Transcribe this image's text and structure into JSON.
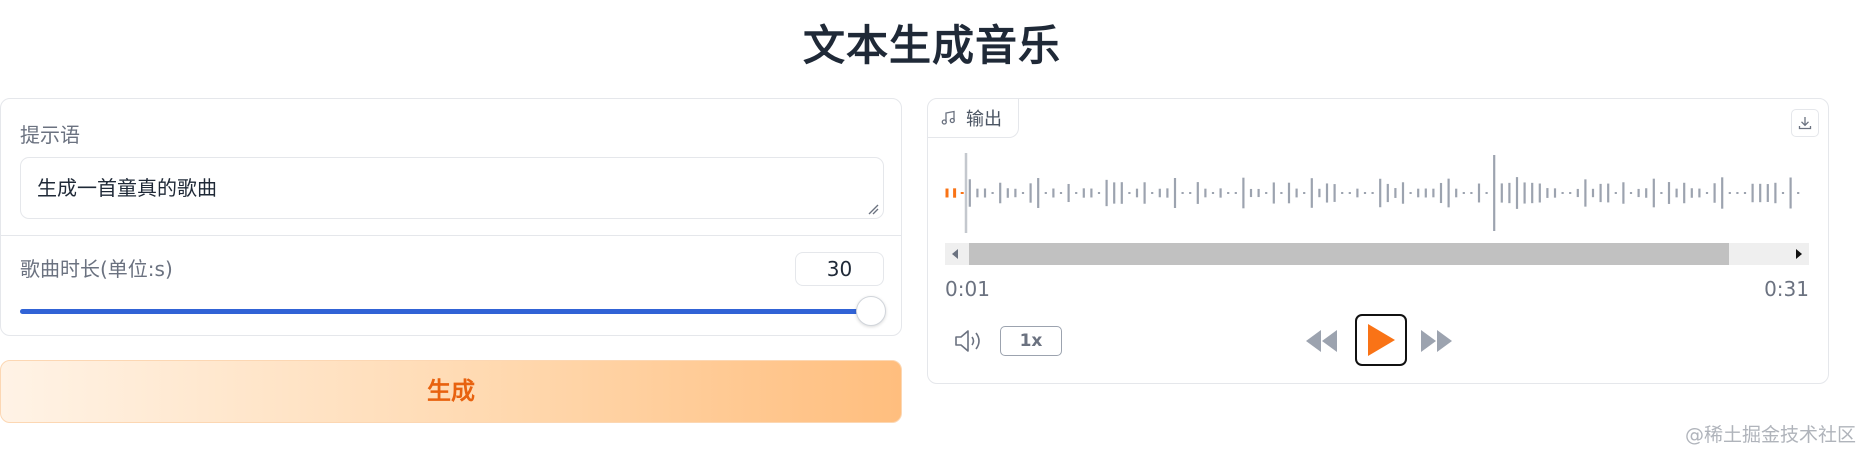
{
  "header": {
    "title": "文本生成音乐"
  },
  "input_panel": {
    "prompt_label": "提示语",
    "prompt_value": "生成一首童真的歌曲",
    "duration_label": "歌曲时长(单位:s)",
    "duration_value": "30",
    "slider_fraction": 1.0
  },
  "generate_button": {
    "label": "生成"
  },
  "output_panel": {
    "tab_label": "输出",
    "tab_icon": "music-note-icon",
    "download_icon": "download-icon",
    "time_current": "0:01",
    "time_total": "0:31",
    "speed_label": "1x",
    "playback_fraction": 0.02
  },
  "colors": {
    "accent_blue": "#3163d6",
    "accent_orange": "#f97316",
    "generate_text": "#e8620f",
    "waveform_gray": "#9ca3af"
  },
  "watermark": "@稀土掘金技术社区"
}
